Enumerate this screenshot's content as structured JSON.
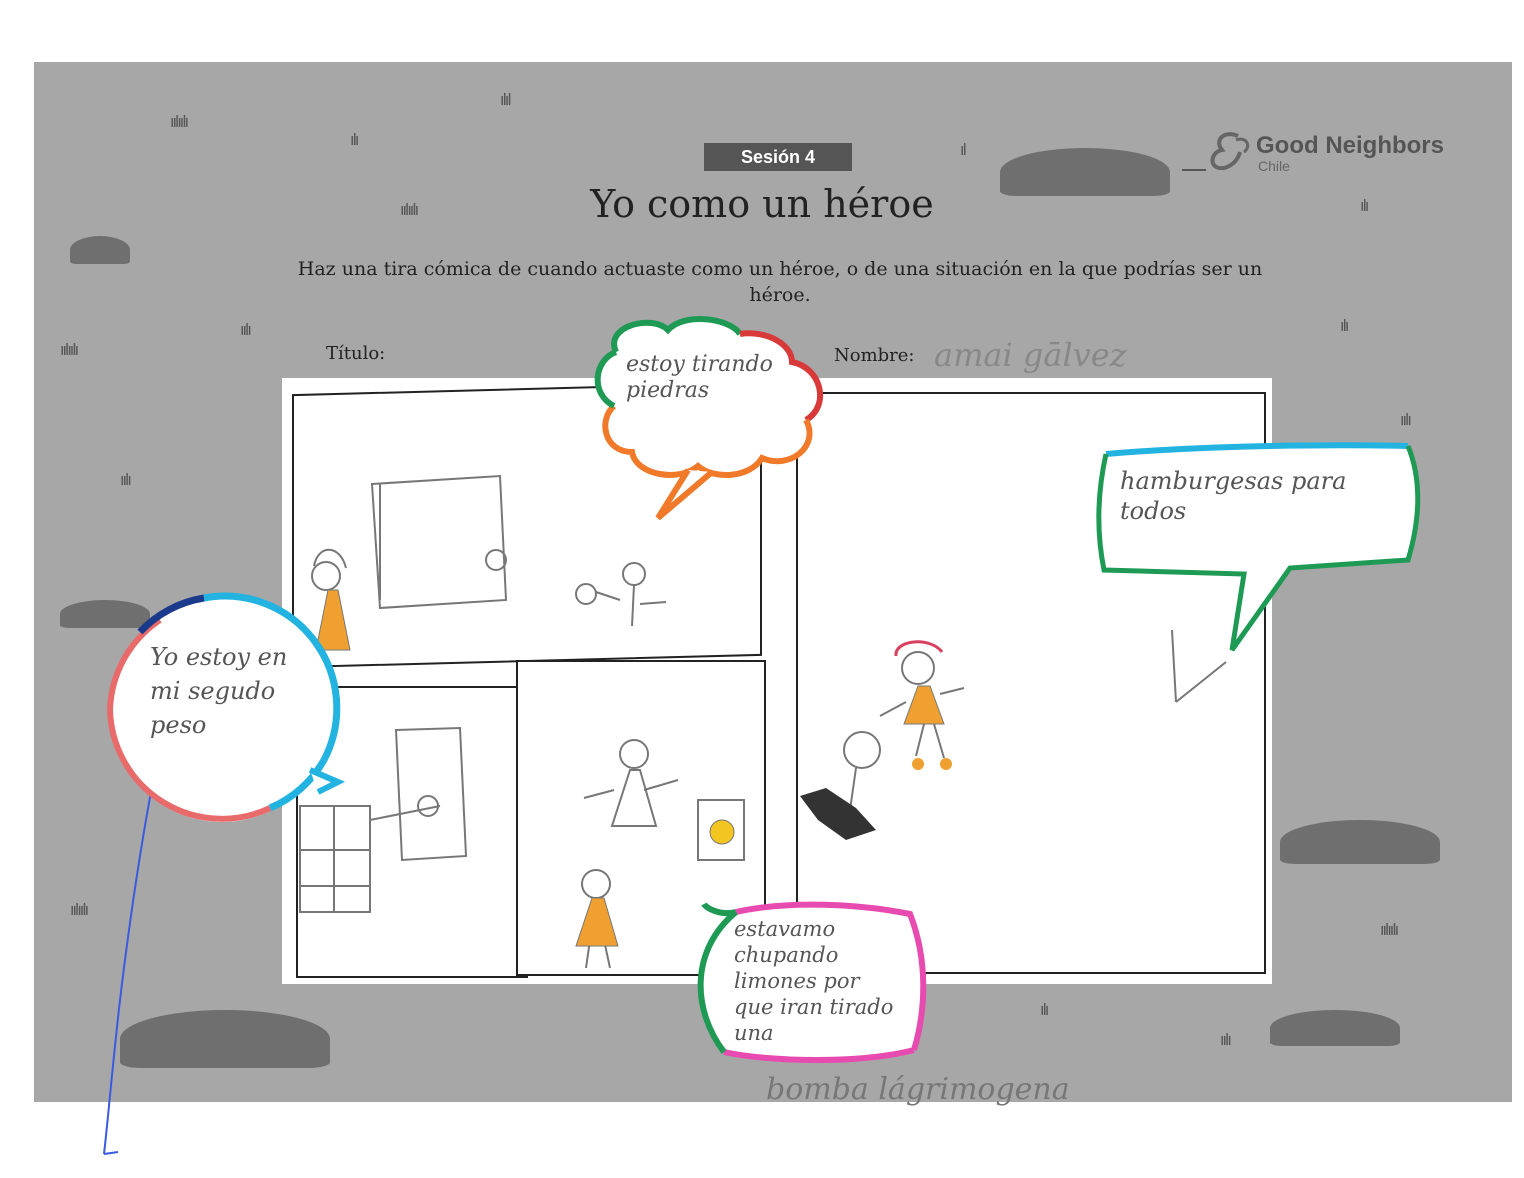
{
  "header": {
    "session_label": "Sesión 4",
    "title": "Yo como un héroe",
    "instructions": "Haz una tira cómica de cuando actuaste como un héroe, o de una situación en la que podrías ser un héroe."
  },
  "logo": {
    "brand": "Good Neighbors",
    "sub": "Chile"
  },
  "form": {
    "title_label": "Título:",
    "name_label": "Nombre:",
    "name_value": "amai gālvez"
  },
  "bubbles": {
    "top": "estoy tirando piedras",
    "left": "Yo estoy en mi segudo peso",
    "right": "hamburgesas para todos",
    "bottom": "estavamo chupando limones por que iran tirado una",
    "bottom_extra": "bomba lágrimogena"
  },
  "colors": {
    "sheet": "#a7a7a7",
    "green": "#1f9a55",
    "red": "#d83a3a",
    "orange": "#f07a2a",
    "cyan": "#22b3e0",
    "darkblue": "#1c3a8c",
    "pink": "#e84bb0",
    "figure_orange": "#f0a030"
  }
}
